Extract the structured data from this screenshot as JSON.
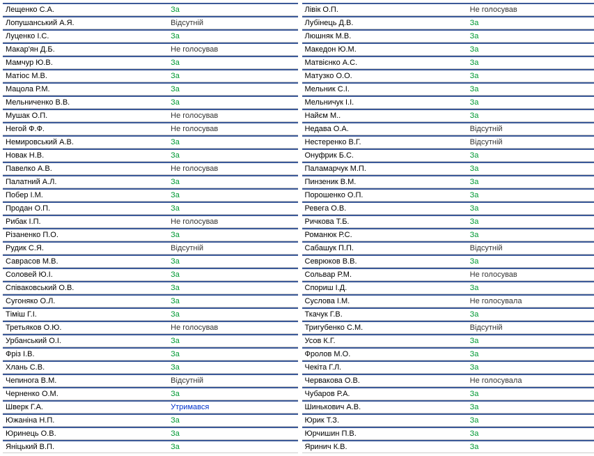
{
  "vote_classes": {
    "За": "v-za",
    "Відсутній": "v-absent",
    "Не голосував": "v-novote",
    "Не голосувала": "v-novote",
    "Утримався": "v-abstain"
  },
  "left": [
    {
      "name": "Лещенко С.А.",
      "vote": "За"
    },
    {
      "name": "Лопушанський А.Я.",
      "vote": "Відсутній"
    },
    {
      "name": "Луценко І.С.",
      "vote": "За"
    },
    {
      "name": "Макар'ян Д.Б.",
      "vote": "Не голосував"
    },
    {
      "name": "Мамчур Ю.В.",
      "vote": "За"
    },
    {
      "name": "Матіос М.В.",
      "vote": "За"
    },
    {
      "name": "Мацола Р.М.",
      "vote": "За"
    },
    {
      "name": "Мельниченко В.В.",
      "vote": "За"
    },
    {
      "name": "Мушак О.П.",
      "vote": "Не голосував"
    },
    {
      "name": "Негой Ф.Ф.",
      "vote": "Не голосував"
    },
    {
      "name": "Немировський А.В.",
      "vote": "За"
    },
    {
      "name": "Новак Н.В.",
      "vote": "За"
    },
    {
      "name": "Павелко А.В.",
      "vote": "Не голосував"
    },
    {
      "name": "Палатний А.Л.",
      "vote": "За"
    },
    {
      "name": "Побер І.М.",
      "vote": "За"
    },
    {
      "name": "Продан О.П.",
      "vote": "За"
    },
    {
      "name": "Рибак І.П.",
      "vote": "Не голосував"
    },
    {
      "name": "Різаненко П.О.",
      "vote": "За"
    },
    {
      "name": "Рудик С.Я.",
      "vote": "Відсутній"
    },
    {
      "name": "Саврасов М.В.",
      "vote": "За"
    },
    {
      "name": "Соловей Ю.І.",
      "vote": "За"
    },
    {
      "name": "Співаковський О.В.",
      "vote": "За"
    },
    {
      "name": "Сугоняко О.Л.",
      "vote": "За"
    },
    {
      "name": "Тіміш Г.І.",
      "vote": "За"
    },
    {
      "name": "Третьяков О.Ю.",
      "vote": "Не голосував"
    },
    {
      "name": "Урбанський О.І.",
      "vote": "За"
    },
    {
      "name": "Фріз І.В.",
      "vote": "За"
    },
    {
      "name": "Хлань С.В.",
      "vote": "За"
    },
    {
      "name": "Чепинога В.М.",
      "vote": "Відсутній"
    },
    {
      "name": "Черненко О.М.",
      "vote": "За"
    },
    {
      "name": "Шверк Г.А.",
      "vote": "Утримався"
    },
    {
      "name": "Южаніна Н.П.",
      "vote": "За"
    },
    {
      "name": "Юринець О.В.",
      "vote": "За"
    },
    {
      "name": "Яніцький В.П.",
      "vote": "За"
    }
  ],
  "right": [
    {
      "name": "Лівік О.П.",
      "vote": "Не голосував"
    },
    {
      "name": "Лубінець Д.В.",
      "vote": "За"
    },
    {
      "name": "Люшняк М.В.",
      "vote": "За"
    },
    {
      "name": "Македон Ю.М.",
      "vote": "За"
    },
    {
      "name": "Матвієнко А.С.",
      "vote": "За"
    },
    {
      "name": "Матузко О.О.",
      "vote": "За"
    },
    {
      "name": "Мельник С.І.",
      "vote": "За"
    },
    {
      "name": "Мельничук І.І.",
      "vote": "За"
    },
    {
      "name": "Найєм М..",
      "vote": "За"
    },
    {
      "name": "Недава О.А.",
      "vote": "Відсутній"
    },
    {
      "name": "Нестеренко В.Г.",
      "vote": "Відсутній"
    },
    {
      "name": "Онуфрик Б.С.",
      "vote": "За"
    },
    {
      "name": "Паламарчук М.П.",
      "vote": "За"
    },
    {
      "name": "Пинзеник В.М.",
      "vote": "За"
    },
    {
      "name": "Порошенко О.П.",
      "vote": "За"
    },
    {
      "name": "Ревега О.В.",
      "vote": "За"
    },
    {
      "name": "Ричкова Т.Б.",
      "vote": "За"
    },
    {
      "name": "Романюк Р.С.",
      "vote": "За"
    },
    {
      "name": "Сабашук П.П.",
      "vote": "Відсутній"
    },
    {
      "name": "Севрюков В.В.",
      "vote": "За"
    },
    {
      "name": "Сольвар Р.М.",
      "vote": "Не голосував"
    },
    {
      "name": "Спориш І.Д.",
      "vote": "За"
    },
    {
      "name": "Суслова І.М.",
      "vote": "Не голосувала"
    },
    {
      "name": "Ткачук Г.В.",
      "vote": "За"
    },
    {
      "name": "Тригубенко С.М.",
      "vote": "Відсутній"
    },
    {
      "name": "Усов К.Г.",
      "vote": "За"
    },
    {
      "name": "Фролов М.О.",
      "vote": "За"
    },
    {
      "name": "Чекіта Г.Л.",
      "vote": "За"
    },
    {
      "name": "Червакова О.В.",
      "vote": "Не голосувала"
    },
    {
      "name": "Чубаров Р.А.",
      "vote": "За"
    },
    {
      "name": "Шинькович А.В.",
      "vote": "За"
    },
    {
      "name": "Юрик Т.З.",
      "vote": "За"
    },
    {
      "name": "Юрчишин П.В.",
      "vote": "За"
    },
    {
      "name": "Яринич К.В.",
      "vote": "За"
    }
  ]
}
